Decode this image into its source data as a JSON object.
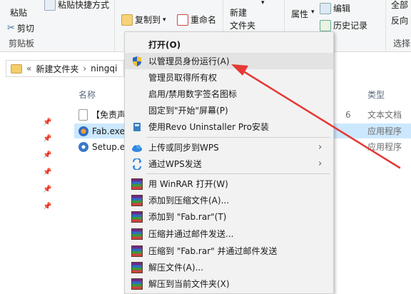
{
  "ribbon": {
    "paste": "粘贴",
    "paste_shortcut": "粘贴快捷方式",
    "cut": "剪切",
    "clipboard_group": "剪贴板",
    "copy_to": "复制到",
    "rename": "重命名",
    "new_folder_line1": "新建",
    "new_folder_line2": "文件夹",
    "properties": "属性",
    "edit": "编辑",
    "history": "历史记录",
    "select_all": "全部",
    "invert_select": "反向",
    "select_group": "选择"
  },
  "address": {
    "chevron": "«",
    "folder1": "新建文件夹",
    "sep": "›",
    "folder2": "ningqi"
  },
  "columns": {
    "name": "名称",
    "type": "类型"
  },
  "files": [
    {
      "name": "【免责声",
      "date": "6",
      "type": "文本文档",
      "icon": "text-file-icon"
    },
    {
      "name": "Fab.exe",
      "date": "",
      "type": "应用程序",
      "icon": "exe-icon"
    },
    {
      "name": "Setup.e",
      "date": "",
      "type": "应用程序",
      "icon": "setup-icon"
    }
  ],
  "menu": {
    "items": [
      {
        "label": "打开(O)",
        "bold": true
      },
      {
        "label": "以管理员身份运行(A)",
        "icon": "shield-icon"
      },
      {
        "label": "管理员取得所有权"
      },
      {
        "label": "启用/禁用数字签名图标"
      },
      {
        "label": "固定到\"开始\"屏幕(P)"
      },
      {
        "label": "使用Revo Uninstaller Pro安装",
        "icon": "revo-icon"
      },
      {
        "label": "上传或同步到WPS",
        "icon": "cloud-icon",
        "submenu": true
      },
      {
        "label": "通过WPS发送",
        "icon": "wps-send-icon",
        "submenu": true
      },
      {
        "label": "用 WinRAR 打开(W)",
        "icon": "winrar-icon"
      },
      {
        "label": "添加到压缩文件(A)...",
        "icon": "winrar-icon"
      },
      {
        "label": "添加到 \"Fab.rar\"(T)",
        "icon": "winrar-icon"
      },
      {
        "label": "压缩并通过邮件发送...",
        "icon": "winrar-icon"
      },
      {
        "label": "压缩到 \"Fab.rar\" 并通过邮件发送",
        "icon": "winrar-icon"
      },
      {
        "label": "解压文件(A)...",
        "icon": "winrar-icon"
      },
      {
        "label": "解压到当前文件夹(X)",
        "icon": "winrar-icon"
      }
    ],
    "submenu_arrow": "›"
  },
  "colors": {
    "selection": "#cce8ff",
    "annotation_arrow": "#e53935",
    "menu_bg": "#f2f2f2"
  }
}
